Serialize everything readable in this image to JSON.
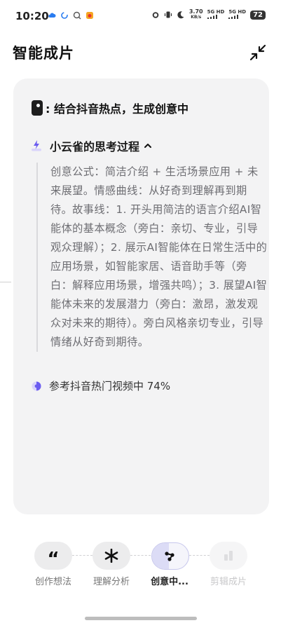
{
  "status_bar": {
    "time": "10:20",
    "net_speed_value": "3.70",
    "net_speed_unit": "KB/s",
    "sig1": "5G HD",
    "sig2": "5G HD",
    "battery": "72"
  },
  "header": {
    "title": "智能成片",
    "collapse_icon": "collapse-arrows-icon"
  },
  "card": {
    "stage_text": ": 结合抖音热点，生成创意中",
    "thinking_label": "小云雀的思考过程",
    "thought_text": "创意公式：简洁介绍 + 生活场景应用 + 未来展望。情感曲线：从好奇到理解再到期待。故事线：1. 开头用简洁的语言介绍AI智能体的基本概念（旁白：亲切、专业，引导观众理解）；2. 展示AI智能体在日常生活中的应用场景，如智能家居、语音助手等（旁白：解释应用场景，增强共鸣）；3. 展望AI智能体未来的发展潜力（旁白：激昂，激发观众对未来的期待）。旁白风格亲切专业，引导情绪从好奇到期待。",
    "reference_text": "参考抖音热门视频中 74%"
  },
  "steps": [
    {
      "label": "创作想法",
      "icon": "quote-icon",
      "state": "done"
    },
    {
      "label": "理解分析",
      "icon": "asterisk-icon",
      "state": "done"
    },
    {
      "label": "创意中...",
      "icon": "nodes-icon",
      "state": "active"
    },
    {
      "label": "剪辑成片",
      "icon": "clip-icon",
      "state": "disabled"
    }
  ],
  "colors": {
    "card_bg": "#f3f3f4",
    "accent_purple": "#6b5cf0",
    "thought_text": "#6d6d72"
  }
}
